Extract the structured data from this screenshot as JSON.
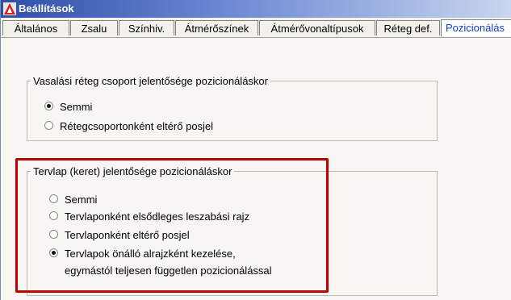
{
  "window": {
    "title": "Beállítások"
  },
  "tabs": [
    {
      "label": "Általános"
    },
    {
      "label": "Zsalu"
    },
    {
      "label": "Színhiv."
    },
    {
      "label": "Átmérőszínek"
    },
    {
      "label": "Átmérővonaltípusok"
    },
    {
      "label": "Réteg def."
    },
    {
      "label": "Pozicionálás"
    }
  ],
  "active_tab": "Pozicionálás",
  "group1": {
    "legend": "Vasalási réteg csoport jelentősége pozicionáláskor",
    "options": [
      {
        "label": "Semmi",
        "checked": true
      },
      {
        "label": "Rétegcsoportonként eltérő posjel",
        "checked": false
      }
    ]
  },
  "group2": {
    "legend": "Tervlap (keret) jelentősége pozicionáláskor",
    "options": [
      {
        "label": "Semmi",
        "checked": false
      },
      {
        "label": "Tervlaponként elsődleges leszabási rajz",
        "checked": false
      },
      {
        "label": "Tervlaponként eltérő posjel",
        "checked": false
      },
      {
        "label": "Tervlapok önálló alrajzként kezelése,",
        "label2": "egymástól teljesen független pozicionálással",
        "checked": true
      }
    ]
  },
  "colors": {
    "highlight_border": "#c00000",
    "active_tab_text": "#1040c8",
    "title_bar": "#2f4fa8"
  }
}
